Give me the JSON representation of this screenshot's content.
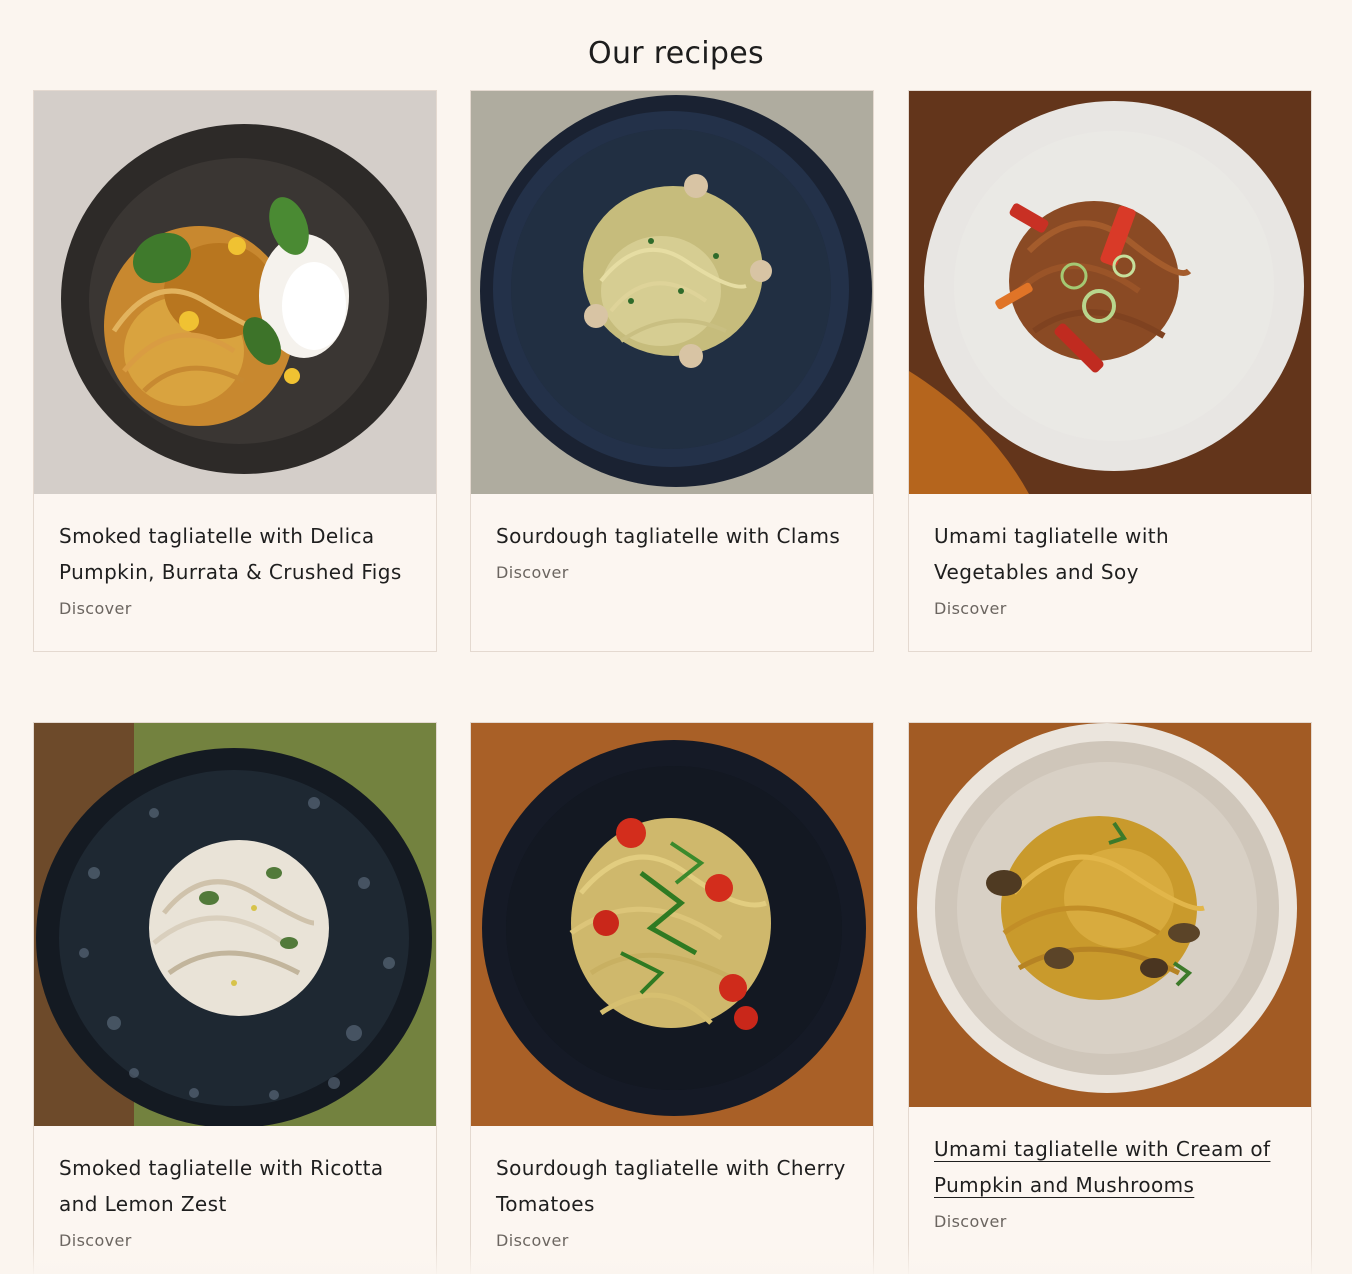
{
  "section": {
    "title": "Our recipes"
  },
  "recipes": [
    {
      "title": "Smoked tagliatelle with Delica Pumpkin, Burrata & Crushed Figs",
      "cta": "Discover",
      "image_alt": "Smoked tagliatelle with pumpkin, burrata and basil in a dark bowl"
    },
    {
      "title": "Sourdough tagliatelle with Clams",
      "cta": "Discover",
      "image_alt": "Sourdough tagliatelle with clams on a navy plate"
    },
    {
      "title": "Umami tagliatelle with Vegetables and Soy",
      "cta": "Discover",
      "image_alt": "Umami tagliatelle with peppers and leeks on a white plate"
    },
    {
      "title": "Smoked tagliatelle with Ricotta and Lemon Zest",
      "cta": "Discover",
      "image_alt": "Smoked tagliatelle with ricotta and lemon zest in a speckled bowl"
    },
    {
      "title": "Sourdough tagliatelle with Cherry Tomatoes",
      "cta": "Discover",
      "image_alt": "Sourdough tagliatelle with cherry tomatoes and arugula in a black bowl"
    },
    {
      "title": "Umami tagliatelle with Cream of Pumpkin and Mushrooms",
      "cta": "Discover",
      "image_alt": "Umami tagliatelle with pumpkin cream and mushrooms on a beige plate"
    }
  ],
  "colors": {
    "background": "#fbf5ef",
    "card_border": "#e4d9d0",
    "text": "#1f1f1f",
    "muted": "#6b6560"
  }
}
